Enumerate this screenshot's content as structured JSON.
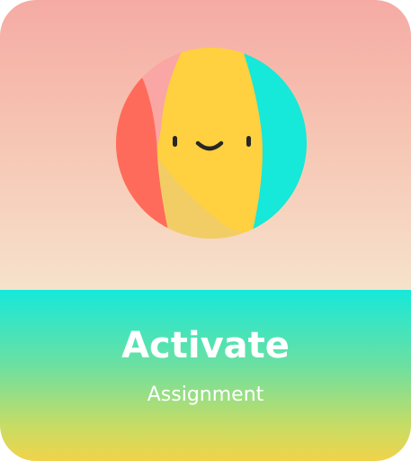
{
  "card": {
    "title": "Activate",
    "subtitle": "Assignment"
  },
  "colors": {
    "top_gradient_start": "#f5aba4",
    "top_gradient_end": "#f6e2cc",
    "bottom_gradient_start": "#16e8da",
    "bottom_gradient_end": "#f1d34a",
    "ball_red": "#ff6b5b",
    "ball_pink": "#f9a6a4",
    "ball_yellow": "#ffd03f",
    "ball_tan": "#f2cd66",
    "ball_cyan": "#16e8da",
    "face": "#262626"
  },
  "icons": {
    "mascot": "smiling-beach-ball-icon"
  }
}
